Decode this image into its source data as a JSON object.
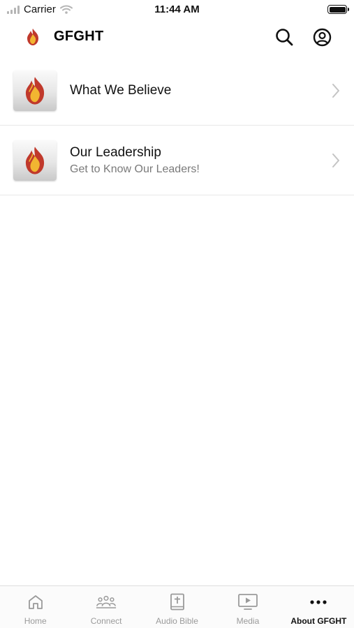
{
  "status_bar": {
    "carrier": "Carrier",
    "time": "11:44 AM"
  },
  "header": {
    "title": "GFGHT",
    "logo_icon": "flame-logo-icon",
    "actions": [
      "search-icon",
      "account-icon"
    ]
  },
  "items": [
    {
      "title": "What We Believe",
      "subtitle": "",
      "icon": "flame-logo-icon"
    },
    {
      "title": "Our Leadership",
      "subtitle": "Get to Know Our Leaders!",
      "icon": "flame-logo-icon"
    }
  ],
  "tabs": [
    {
      "label": "Home",
      "icon": "home-icon",
      "active": false
    },
    {
      "label": "Connect",
      "icon": "people-icon",
      "active": false
    },
    {
      "label": "Audio Bible",
      "icon": "bible-icon",
      "active": false
    },
    {
      "label": "Media",
      "icon": "play-screen-icon",
      "active": false
    },
    {
      "label": "About GFGHT",
      "icon": "more-icon",
      "active": true
    }
  ],
  "colors": {
    "accent": "#111111",
    "inactive_tab": "#9a9a9a",
    "subtitle": "#7a7a7a",
    "divider": "#e8e8e8",
    "flame_outer": "#c0392b",
    "flame_inner": "#f2b531"
  }
}
